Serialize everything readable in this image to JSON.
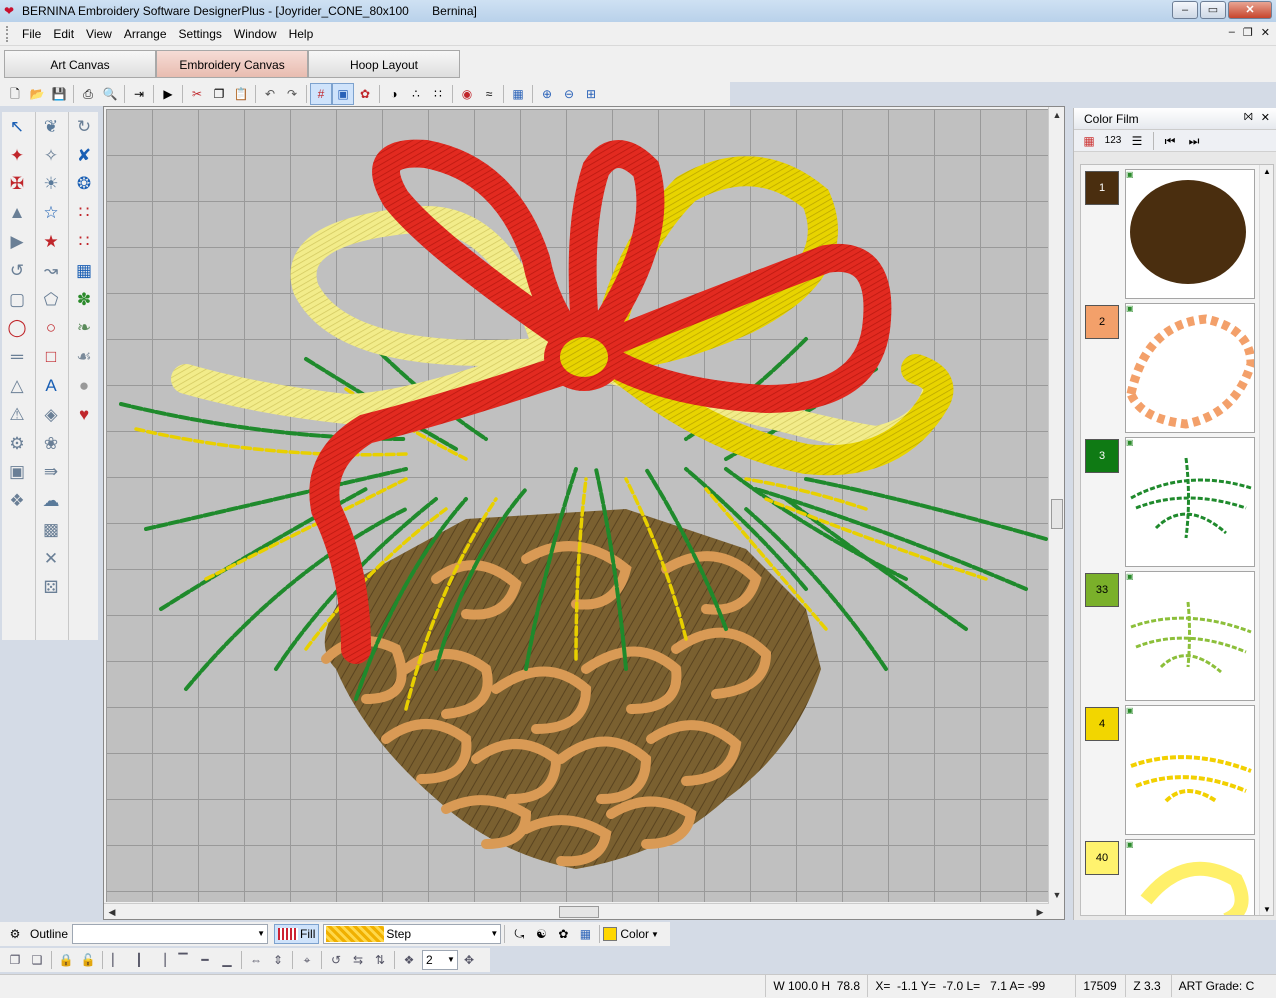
{
  "window": {
    "title": "BERNINA Embroidery Software DesignerPlus - [Joyrider_CONE_80x100       Bernina]",
    "min_label": "–",
    "max_label": "▭",
    "close_label": "✕"
  },
  "menu": {
    "items": [
      "File",
      "Edit",
      "View",
      "Arrange",
      "Settings",
      "Window",
      "Help"
    ],
    "mdi_min": "–",
    "mdi_restore": "❐",
    "mdi_close": "✕"
  },
  "canvas_tabs": [
    {
      "label": "Art Canvas",
      "active": false
    },
    {
      "label": "Embroidery Canvas",
      "active": true
    },
    {
      "label": "Hoop Layout",
      "active": false
    }
  ],
  "toolbar_icons": [
    "new-icon",
    "open-icon",
    "save-icon",
    "sep",
    "print-icon",
    "print-preview-icon",
    "sep",
    "export-icon",
    "sep",
    "stitch-player-icon",
    "sep",
    "cut-icon",
    "copy-icon",
    "paste-icon",
    "sep",
    "undo-icon",
    "redo-icon",
    "sep",
    "grid-icon",
    "hoop-icon",
    "show-stitches-icon",
    "sep",
    "artistic-view-icon",
    "needle-points-icon",
    "connectors-icon",
    "sep",
    "color-wheel-icon",
    "fabric-icon",
    "sep",
    "thread-chart-icon",
    "sep",
    "zoom-in-icon",
    "zoom-out-icon",
    "zoom-fit-icon"
  ],
  "palette": {
    "col1": [
      "select-arrow-icon",
      "reshape-icon",
      "knife-icon",
      "triangle-icon",
      "mirror-icon",
      "rotate-icon",
      "scale-icon",
      "ring-icon",
      "align-icon",
      "distribute-icon",
      "warning-icon",
      "settings-icon",
      "wand-icon",
      "node-icon"
    ],
    "col2": [
      "bird-icon",
      "magic-wand-icon",
      "sun-icon",
      "star-outline-icon",
      "star-filled-icon",
      "spiral-icon",
      "polygon-icon",
      "circle-icon",
      "square-icon",
      "lettering-icon",
      "monogram-icon",
      "badge-icon",
      "flow-icon",
      "cloud-icon",
      "stippling-icon",
      "cross-stitch-icon",
      "dice-icon"
    ],
    "col3": [
      "refresh-icon",
      "outline-design-icon",
      "buttonhole-icon",
      "row-icon",
      "dot-grid-icon",
      "blue-grid-icon",
      "motif-icon",
      "leaf-icon",
      "feather-icon",
      "circle-motif-icon",
      "heart-icon"
    ]
  },
  "color_film": {
    "title": "Color Film",
    "pin_label": "⨝",
    "close_label": "✕",
    "items": [
      {
        "number": "1",
        "swatch": "#4a2e0f",
        "thread": "#4a2e0f",
        "text_color": "#ffffff"
      },
      {
        "number": "2",
        "swatch": "#f3a06a",
        "thread": "#f3a06a",
        "text_color": "#000000"
      },
      {
        "number": "3",
        "swatch": "#0f7a14",
        "thread": "#1f8a2c",
        "text_color": "#ffffff"
      },
      {
        "number": "33",
        "swatch": "#7ab02a",
        "thread": "#8cbf3a",
        "text_color": "#000000"
      },
      {
        "number": "4",
        "swatch": "#f2d600",
        "thread": "#f2d000",
        "text_color": "#000000"
      },
      {
        "number": "40",
        "swatch": "#fff36e",
        "thread": "#fff06a",
        "text_color": "#000000"
      }
    ]
  },
  "properties": {
    "outline_label": "Outline",
    "outline_value": "",
    "fill_label": "Fill",
    "step_label": "Step",
    "color_label": "Color"
  },
  "arrange": {
    "spin_value": "2"
  },
  "status": {
    "size": " W 100.0 H  78.8",
    "coords": " X=  -1.1 Y=  -7.0 L=   7.1 A= -99",
    "stitches": " 17509",
    "zoom": " Z 3.3",
    "grade": " ART Grade: C"
  }
}
